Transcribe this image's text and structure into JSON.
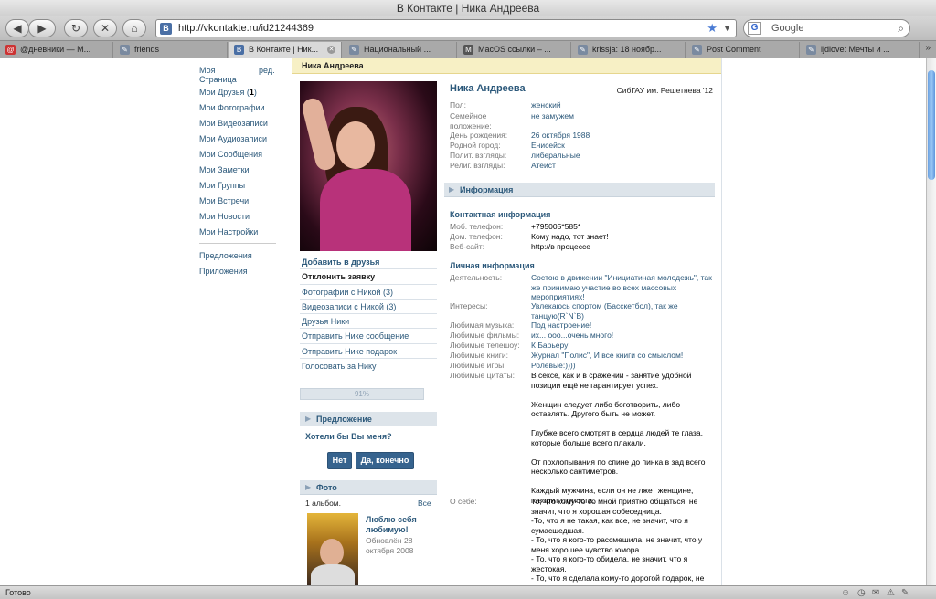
{
  "browser": {
    "window_title": "В Контакте | Ника Андреева",
    "url": "http://vkontakte.ru/id21244369",
    "search_placeholder": "Google",
    "status": "Готово",
    "tabs": [
      {
        "label": "@дневники — М...",
        "icon": "dnevniki-icon",
        "color": "#cc3333"
      },
      {
        "label": "friends",
        "icon": "link-icon",
        "color": "#7a8aa0"
      },
      {
        "label": "В Контакте | Ник...",
        "icon": "vk-icon",
        "color": "#4a6fa5",
        "active": true
      },
      {
        "label": "Национальный ...",
        "icon": "link-icon",
        "color": "#7a8aa0"
      },
      {
        "label": "MacOS ссылки – ...",
        "icon": "link-icon",
        "color": "#555555"
      },
      {
        "label": "krissja: 18 ноябр...",
        "icon": "link-icon",
        "color": "#7a8aa0"
      },
      {
        "label": "Post Comment",
        "icon": "link-icon",
        "color": "#7a8aa0"
      },
      {
        "label": "ljdlove: Мечты и ...",
        "icon": "link-icon",
        "color": "#7a8aa0"
      }
    ]
  },
  "nav": {
    "my_page": "Моя Страница",
    "edit": "ред.",
    "friends": "Мои Друзья",
    "friends_count": "1",
    "items": [
      "Мои Фотографии",
      "Мои Видеозаписи",
      "Мои Аудиозаписи",
      "Мои Сообщения",
      "Мои Заметки",
      "Мои Группы",
      "Мои Встречи",
      "Мои Новости",
      "Мои Настройки"
    ],
    "bottom": [
      "Предложения",
      "Приложения"
    ]
  },
  "page": {
    "header": "Ника Андреева",
    "name": "Ника Андреева",
    "school": "СибГАУ им. Решетнева '12",
    "basic": [
      {
        "label": "Пол:",
        "value": "женский"
      },
      {
        "label": "Семейное положение:",
        "value": "не замужем"
      },
      {
        "label": "День рождения:",
        "value": "26 октября 1988"
      },
      {
        "label": "Родной город:",
        "value": "Енисейск"
      },
      {
        "label": "Полит. взгляды:",
        "value": "либеральные"
      },
      {
        "label": "Религ. взгляды:",
        "value": "Атеист"
      }
    ],
    "info_title": "Информация",
    "contact_title": "Контактная информация",
    "contacts": [
      {
        "label": "Моб. телефон:",
        "value": "+795005*585*"
      },
      {
        "label": "Дом. телефон:",
        "value": "Кому надо, тот знает!"
      },
      {
        "label": "Веб-сайт:",
        "value": "http://в процессе"
      }
    ],
    "personal_title": "Личная информация",
    "personal": [
      {
        "label": "Деятельность:",
        "value": "Состою в движении \"Инициатиная молодежь\", так же принимаю участие во всех массовых мероприятиях!"
      },
      {
        "label": "Интересы:",
        "value": "Увлекаюсь спортом (Басскетбол), так же танцую(R`N`B)"
      },
      {
        "label": "Любимая музыка:",
        "value": "Под настроение!"
      },
      {
        "label": "Любимые фильмы:",
        "value": "их... ооо...очень много!"
      },
      {
        "label": "Любимые телешоу:",
        "value": "К Барьеру!"
      },
      {
        "label": "Любимые книги:",
        "value": "Журнал \"Полис\", И все книги со смыслом!"
      },
      {
        "label": "Любимые игры:",
        "value": "Ролевые:))))"
      },
      {
        "label": "Любимые цитаты:",
        "value": "В сексе, как и в сражении - занятие удобной позиции ещё не гарантирует успех.\n\nЖенщин следует либо боготворить, либо оставлять. Другого быть не может.\n\nГлубже всего смотрят в сердца людей те глаза, которые больше всего плакали.\n\nОт похлопывания по спине до пинка в зад всего несколько сантиметров.\n\nКаждый мужчина, если он не лжет женщине, говорит глупости."
      },
      {
        "label": "О себе:",
        "value": "То, что кому-то со мной приятно общаться, не значит, что я хорошая собеседница.\n-То, что я не такая, как все, не значит, что я сумасшедшая.\n- То, что я кого-то рассмешила, не значит, что у меня хорошее чувство юмора.\n- То, что я кого-то обидела, не значит, что я жестокая.\n- То, что я сделала кому-то дорогой подарок, не значит, что я щедрая."
      }
    ],
    "actions": [
      "Добавить в друзья",
      "Отклонить заявку",
      "Фотографии с Никой (3)",
      "Видеозаписи с Никой (3)",
      "Друзья Ники",
      "Отправить Нике сообщение",
      "Отправить Нике подарок",
      "Голосовать за Нику"
    ],
    "rating_text": "91%",
    "rating_value": 0.91,
    "proposal_title": "Предложение",
    "proposal_question": "Хотели бы Вы меня?",
    "btn_no": "Нет",
    "btn_yes": "Да, конечно",
    "photo_title": "Фото",
    "albums_count": "1 альбом.",
    "albums_all": "Все",
    "album_title": "Люблю себя любимую!",
    "album_updated": "Обновлён 28 октября 2008"
  }
}
